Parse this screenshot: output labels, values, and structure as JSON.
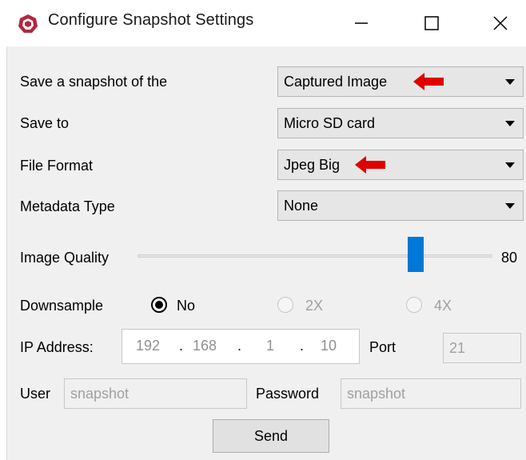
{
  "window": {
    "title": "Configure Snapshot Settings",
    "icon": "app-logo-icon",
    "controls": [
      "minimize-icon",
      "maximize-icon",
      "close-icon"
    ]
  },
  "form": {
    "snapshot_of": {
      "label": "Save a snapshot of the",
      "value": "Captured Image",
      "annotated": true
    },
    "save_to": {
      "label": "Save to",
      "value": "Micro SD card"
    },
    "file_format": {
      "label": "File Format",
      "value": "Jpeg Big",
      "annotated": true
    },
    "metadata_type": {
      "label": "Metadata Type",
      "value": "None"
    },
    "image_quality": {
      "label": "Image Quality",
      "value": "80",
      "fraction": 0.8
    },
    "downsample": {
      "label": "Downsample",
      "options": [
        {
          "label": "No",
          "selected": true,
          "enabled": true
        },
        {
          "label": "2X",
          "selected": false,
          "enabled": false
        },
        {
          "label": "4X",
          "selected": false,
          "enabled": false
        }
      ]
    },
    "ip_address": {
      "label": "IP Address:",
      "octets": [
        "192",
        "168",
        "1",
        "10"
      ],
      "separator": "."
    },
    "port": {
      "label": "Port",
      "value": "21"
    },
    "user": {
      "label": "User",
      "value": "snapshot"
    },
    "password": {
      "label": "Password",
      "value": "snapshot"
    },
    "send_label": "Send"
  },
  "colors": {
    "accent": "#0078d7",
    "annotation_arrow": "#e00000",
    "dialog_bg": "#f0f0f0",
    "disabled_text": "#a0a0a0"
  }
}
